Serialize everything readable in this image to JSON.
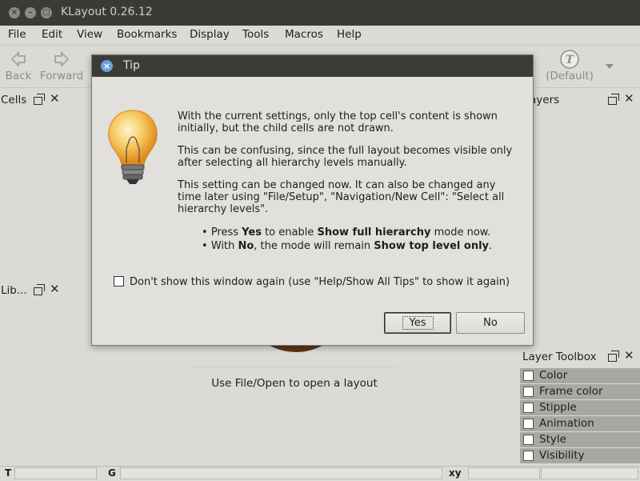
{
  "window": {
    "title": "KLayout 0.26.12"
  },
  "menu": [
    "File",
    "Edit",
    "View",
    "Bookmarks",
    "Display",
    "Tools",
    "Macros",
    "Help"
  ],
  "toolbar": {
    "back": "Back",
    "forward": "Forward",
    "default_label": "(Default)"
  },
  "docks": {
    "cells": "Cells",
    "libraries": "Lib...",
    "layers": "ayers",
    "layer_toolbox": "Layer Toolbox"
  },
  "center_message": "Use File/Open to open a layout",
  "toolbox_items": [
    "Color",
    "Frame color",
    "Stipple",
    "Animation",
    "Style",
    "Visibility"
  ],
  "status": {
    "t": "T",
    "g": "G",
    "xy": "xy"
  },
  "dialog": {
    "title": "Tip",
    "para1": "With the current settings, only the top cell's content is shown initially, but the child cells are not drawn.",
    "para2": "This can be confusing, since the full layout becomes visible only after selecting all hierarchy levels manually.",
    "para3": "This setting can be changed now. It can also be changed any time later using \"File/Setup\", \"Navigation/New Cell\": \"Select all hierarchy levels\".",
    "bullet1": {
      "a": "Press ",
      "b": "Yes",
      "c": " to enable ",
      "d": "Show full hierarchy",
      "e": " mode now."
    },
    "bullet2": {
      "a": "With ",
      "b": "No",
      "c": ", the mode will remain ",
      "d": "Show top level only",
      "e": "."
    },
    "checkbox": "Don't show this window again (use \"Help/Show All Tips\" to show it again)",
    "yes": "Yes",
    "no": "No"
  }
}
